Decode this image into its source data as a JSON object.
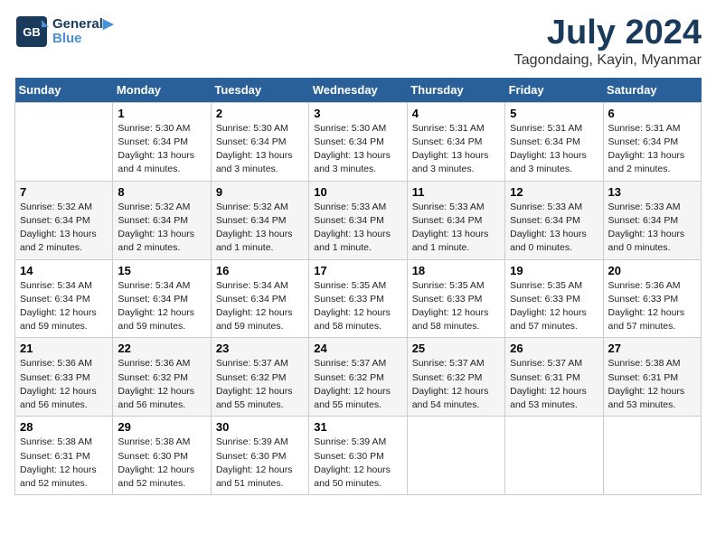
{
  "logo": {
    "line1": "General",
    "line2": "Blue"
  },
  "header": {
    "title": "July 2024",
    "subtitle": "Tagondaing, Kayin, Myanmar"
  },
  "columns": [
    "Sunday",
    "Monday",
    "Tuesday",
    "Wednesday",
    "Thursday",
    "Friday",
    "Saturday"
  ],
  "weeks": [
    [
      {
        "day": "",
        "info": ""
      },
      {
        "day": "1",
        "info": "Sunrise: 5:30 AM\nSunset: 6:34 PM\nDaylight: 13 hours\nand 4 minutes."
      },
      {
        "day": "2",
        "info": "Sunrise: 5:30 AM\nSunset: 6:34 PM\nDaylight: 13 hours\nand 3 minutes."
      },
      {
        "day": "3",
        "info": "Sunrise: 5:30 AM\nSunset: 6:34 PM\nDaylight: 13 hours\nand 3 minutes."
      },
      {
        "day": "4",
        "info": "Sunrise: 5:31 AM\nSunset: 6:34 PM\nDaylight: 13 hours\nand 3 minutes."
      },
      {
        "day": "5",
        "info": "Sunrise: 5:31 AM\nSunset: 6:34 PM\nDaylight: 13 hours\nand 3 minutes."
      },
      {
        "day": "6",
        "info": "Sunrise: 5:31 AM\nSunset: 6:34 PM\nDaylight: 13 hours\nand 2 minutes."
      }
    ],
    [
      {
        "day": "7",
        "info": "Sunrise: 5:32 AM\nSunset: 6:34 PM\nDaylight: 13 hours\nand 2 minutes."
      },
      {
        "day": "8",
        "info": "Sunrise: 5:32 AM\nSunset: 6:34 PM\nDaylight: 13 hours\nand 2 minutes."
      },
      {
        "day": "9",
        "info": "Sunrise: 5:32 AM\nSunset: 6:34 PM\nDaylight: 13 hours\nand 1 minute."
      },
      {
        "day": "10",
        "info": "Sunrise: 5:33 AM\nSunset: 6:34 PM\nDaylight: 13 hours\nand 1 minute."
      },
      {
        "day": "11",
        "info": "Sunrise: 5:33 AM\nSunset: 6:34 PM\nDaylight: 13 hours\nand 1 minute."
      },
      {
        "day": "12",
        "info": "Sunrise: 5:33 AM\nSunset: 6:34 PM\nDaylight: 13 hours\nand 0 minutes."
      },
      {
        "day": "13",
        "info": "Sunrise: 5:33 AM\nSunset: 6:34 PM\nDaylight: 13 hours\nand 0 minutes."
      }
    ],
    [
      {
        "day": "14",
        "info": "Sunrise: 5:34 AM\nSunset: 6:34 PM\nDaylight: 12 hours\nand 59 minutes."
      },
      {
        "day": "15",
        "info": "Sunrise: 5:34 AM\nSunset: 6:34 PM\nDaylight: 12 hours\nand 59 minutes."
      },
      {
        "day": "16",
        "info": "Sunrise: 5:34 AM\nSunset: 6:34 PM\nDaylight: 12 hours\nand 59 minutes."
      },
      {
        "day": "17",
        "info": "Sunrise: 5:35 AM\nSunset: 6:33 PM\nDaylight: 12 hours\nand 58 minutes."
      },
      {
        "day": "18",
        "info": "Sunrise: 5:35 AM\nSunset: 6:33 PM\nDaylight: 12 hours\nand 58 minutes."
      },
      {
        "day": "19",
        "info": "Sunrise: 5:35 AM\nSunset: 6:33 PM\nDaylight: 12 hours\nand 57 minutes."
      },
      {
        "day": "20",
        "info": "Sunrise: 5:36 AM\nSunset: 6:33 PM\nDaylight: 12 hours\nand 57 minutes."
      }
    ],
    [
      {
        "day": "21",
        "info": "Sunrise: 5:36 AM\nSunset: 6:33 PM\nDaylight: 12 hours\nand 56 minutes."
      },
      {
        "day": "22",
        "info": "Sunrise: 5:36 AM\nSunset: 6:32 PM\nDaylight: 12 hours\nand 56 minutes."
      },
      {
        "day": "23",
        "info": "Sunrise: 5:37 AM\nSunset: 6:32 PM\nDaylight: 12 hours\nand 55 minutes."
      },
      {
        "day": "24",
        "info": "Sunrise: 5:37 AM\nSunset: 6:32 PM\nDaylight: 12 hours\nand 55 minutes."
      },
      {
        "day": "25",
        "info": "Sunrise: 5:37 AM\nSunset: 6:32 PM\nDaylight: 12 hours\nand 54 minutes."
      },
      {
        "day": "26",
        "info": "Sunrise: 5:37 AM\nSunset: 6:31 PM\nDaylight: 12 hours\nand 53 minutes."
      },
      {
        "day": "27",
        "info": "Sunrise: 5:38 AM\nSunset: 6:31 PM\nDaylight: 12 hours\nand 53 minutes."
      }
    ],
    [
      {
        "day": "28",
        "info": "Sunrise: 5:38 AM\nSunset: 6:31 PM\nDaylight: 12 hours\nand 52 minutes."
      },
      {
        "day": "29",
        "info": "Sunrise: 5:38 AM\nSunset: 6:30 PM\nDaylight: 12 hours\nand 52 minutes."
      },
      {
        "day": "30",
        "info": "Sunrise: 5:39 AM\nSunset: 6:30 PM\nDaylight: 12 hours\nand 51 minutes."
      },
      {
        "day": "31",
        "info": "Sunrise: 5:39 AM\nSunset: 6:30 PM\nDaylight: 12 hours\nand 50 minutes."
      },
      {
        "day": "",
        "info": ""
      },
      {
        "day": "",
        "info": ""
      },
      {
        "day": "",
        "info": ""
      }
    ]
  ]
}
